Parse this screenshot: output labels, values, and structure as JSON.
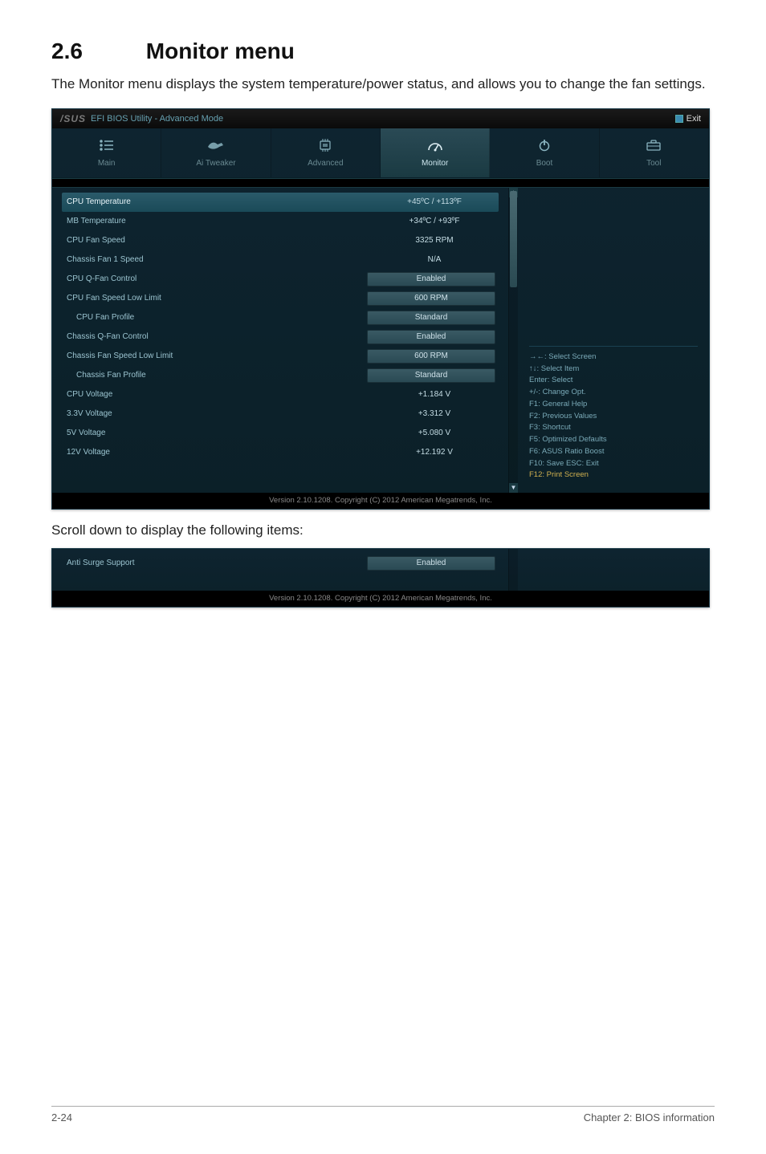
{
  "section": {
    "number": "2.6",
    "title": "Monitor menu"
  },
  "intro": "The Monitor menu displays the system temperature/power status, and allows you to change the fan settings.",
  "bios": {
    "brand": "/SUS",
    "utility": "EFI BIOS Utility - Advanced Mode",
    "exit": "Exit",
    "tabs": {
      "main": "Main",
      "tweaker": "Ai  Tweaker",
      "advanced": "Advanced",
      "monitor": "Monitor",
      "boot": "Boot",
      "tool": "Tool"
    },
    "rows": {
      "cpu_temp": {
        "label": "CPU Temperature",
        "value": "+45ºC / +113ºF"
      },
      "mb_temp": {
        "label": "MB Temperature",
        "value": "+34ºC / +93ºF"
      },
      "cpu_fan": {
        "label": "CPU Fan Speed",
        "value": "3325 RPM"
      },
      "cha_fan1": {
        "label": "Chassis Fan 1 Speed",
        "value": "N/A"
      },
      "cpu_qfan": {
        "label": "CPU Q-Fan Control",
        "value": "Enabled"
      },
      "cpu_fan_low": {
        "label": "CPU Fan Speed Low Limit",
        "value": "600 RPM"
      },
      "cpu_fan_profile": {
        "label": "CPU Fan Profile",
        "value": "Standard"
      },
      "cha_qfan": {
        "label": "Chassis Q-Fan Control",
        "value": "Enabled"
      },
      "cha_fan_low": {
        "label": "Chassis Fan Speed Low Limit",
        "value": "600 RPM"
      },
      "cha_fan_profile": {
        "label": "Chassis Fan Profile",
        "value": "Standard"
      },
      "cpu_v": {
        "label": "CPU Voltage",
        "value": "+1.184 V"
      },
      "v33": {
        "label": "3.3V Voltage",
        "value": "+3.312 V"
      },
      "v5": {
        "label": "5V Voltage",
        "value": "+5.080 V"
      },
      "v12": {
        "label": "12V Voltage",
        "value": "+12.192 V"
      }
    },
    "help": {
      "l1": "→←:  Select Screen",
      "l2": "↑↓:  Select Item",
      "l3": "Enter:  Select",
      "l4": "+/-:  Change Opt.",
      "l5": "F1:  General Help",
      "l6": "F2:  Previous Values",
      "l7": "F3:  Shortcut",
      "l8": "F5:  Optimized Defaults",
      "l9": "F6:  ASUS Ratio Boost",
      "l10": "F10:  Save    ESC:  Exit",
      "l11": "F12:  Print Screen"
    },
    "footer": "Version  2.10.1208.    Copyright  (C)  2012  American  Megatrends,  Inc."
  },
  "mid_text": "Scroll down to display the following items:",
  "bios2": {
    "anti_surge": {
      "label": "Anti Surge Support",
      "value": "Enabled"
    }
  },
  "pagefoot": {
    "left": "2-24",
    "right": "Chapter 2: BIOS information"
  }
}
